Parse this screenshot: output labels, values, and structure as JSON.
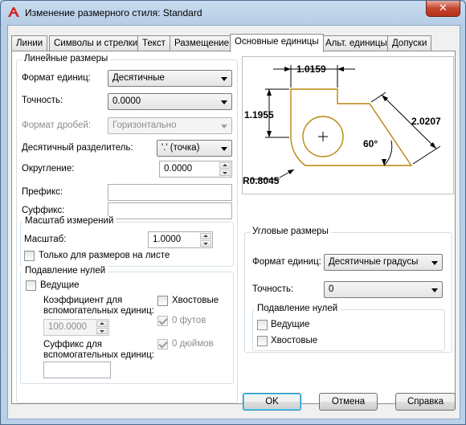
{
  "window": {
    "title": "Изменение размерного стиля: Standard",
    "close_glyph": "✕",
    "app_icon": "autocad-icon"
  },
  "tabs": [
    {
      "label": "Линии"
    },
    {
      "label": "Символы и стрелки"
    },
    {
      "label": "Текст"
    },
    {
      "label": "Размещение"
    },
    {
      "label": "Основные единицы",
      "active": true
    },
    {
      "label": "Альт. единицы"
    },
    {
      "label": "Допуски"
    }
  ],
  "linear": {
    "title": "Линейные размеры",
    "unit_format_label": "Формат единиц:",
    "unit_format_value": "Десятичные",
    "precision_label": "Точность:",
    "precision_value": "0.0000",
    "fraction_format_label": "Формат дробей:",
    "fraction_format_value": "Горизонтально",
    "decimal_sep_label": "Десятичный  разделитель:",
    "decimal_sep_value": "'.' (точка)",
    "round_label": "Округление:",
    "round_value": "0.0000",
    "prefix_label": "Префикс:",
    "prefix_value": "",
    "suffix_label": "Суффикс:",
    "suffix_value": ""
  },
  "scale": {
    "title": "Масштаб измерений",
    "factor_label": "Масштаб:",
    "factor_value": "1.0000",
    "layout_only_label": "Только для размеров на листе",
    "layout_only_checked": false
  },
  "zero_linear": {
    "title": "Подавление нулей",
    "leading_label": "Ведущие",
    "leading_checked": false,
    "sub_factor_label_1": "Коэффициент для",
    "sub_factor_label_2": "вспомогательных единиц:",
    "sub_factor_value": "100.0000",
    "sub_suffix_label_1": "Суффикс для",
    "sub_suffix_label_2": "вспомогательных единиц:",
    "sub_suffix_value": "",
    "trailing_label": "Хвостовые",
    "trailing_checked": false,
    "feet_label": "0 футов",
    "feet_checked": true,
    "inches_label": "0 дюймов",
    "inches_checked": true
  },
  "preview": {
    "dim_top": "1.0159",
    "dim_left": "1.1955",
    "dim_right": "2.0207",
    "dim_angle": "60°",
    "dim_radius": "R0.8045",
    "geometry_color": "#b8860b"
  },
  "angular": {
    "title": "Угловые размеры",
    "unit_format_label": "Формат единиц:",
    "unit_format_value": "Десятичные градусы",
    "precision_label": "Точность:",
    "precision_value": "0"
  },
  "zero_angular": {
    "title": "Подавление нулей",
    "leading_label": "Ведущие",
    "leading_checked": false,
    "trailing_label": "Хвостовые",
    "trailing_checked": false
  },
  "buttons": {
    "ok": "OK",
    "cancel": "Отмена",
    "help": "Справка"
  }
}
